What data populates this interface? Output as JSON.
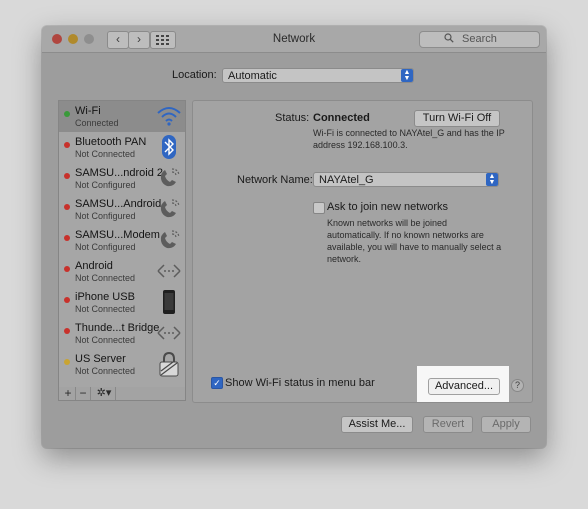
{
  "window": {
    "title": "Network"
  },
  "toolbar": {
    "back_glyph": "‹",
    "forward_glyph": "›",
    "search_placeholder": "Search"
  },
  "location": {
    "label": "Location:",
    "value": "Automatic"
  },
  "services": [
    {
      "name": "Wi-Fi",
      "status": "Connected",
      "dot": "#3a9a3a",
      "icon": "wifi-icon",
      "selected": true
    },
    {
      "name": "Bluetooth PAN",
      "status": "Not Connected",
      "dot": "#c8312b",
      "icon": "bluetooth-icon",
      "selected": false
    },
    {
      "name": "SAMSU...ndroid 2",
      "status": "Not Configured",
      "dot": "#c8312b",
      "icon": "phone-icon",
      "selected": false
    },
    {
      "name": "SAMSU...Android",
      "status": "Not Configured",
      "dot": "#c8312b",
      "icon": "phone-icon",
      "selected": false
    },
    {
      "name": "SAMSU...Modem",
      "status": "Not Configured",
      "dot": "#c8312b",
      "icon": "phone-icon",
      "selected": false
    },
    {
      "name": "Android",
      "status": "Not Connected",
      "dot": "#c8312b",
      "icon": "ethernet-arrows-icon",
      "selected": false
    },
    {
      "name": "iPhone USB",
      "status": "Not Connected",
      "dot": "#c8312b",
      "icon": "iphone-icon",
      "selected": false
    },
    {
      "name": "Thunde...t Bridge",
      "status": "Not Connected",
      "dot": "#c8312b",
      "icon": "ethernet-arrows-icon",
      "selected": false
    },
    {
      "name": "US Server",
      "status": "Not Connected",
      "dot": "#c9a431",
      "icon": "lock-icon",
      "selected": false
    }
  ],
  "sidebar_controls": {
    "add": "+",
    "remove": "−",
    "gear": "✲▾"
  },
  "detail": {
    "status_label": "Status:",
    "status_value": "Connected",
    "turn_off_button": "Turn Wi-Fi Off",
    "status_description": "Wi-Fi is connected to NAYAtel_G and has the IP address 192.168.100.3.",
    "network_name_label": "Network Name:",
    "network_name_value": "NAYAtel_G",
    "ask_join_label": "Ask to join new networks",
    "ask_join_checked": false,
    "ask_join_description": "Known networks will be joined automatically. If no known networks are available, you will have to manually select a network.",
    "show_status_label": "Show Wi-Fi status in menu bar",
    "show_status_checked": true,
    "advanced_button": "Advanced...",
    "help": "?"
  },
  "footer": {
    "assist": "Assist Me...",
    "revert": "Revert",
    "apply": "Apply"
  },
  "colors": {
    "accent": "#2f66c2",
    "connected": "#3a9a3a",
    "disconnected": "#c8312b",
    "vpn": "#c9a431"
  }
}
